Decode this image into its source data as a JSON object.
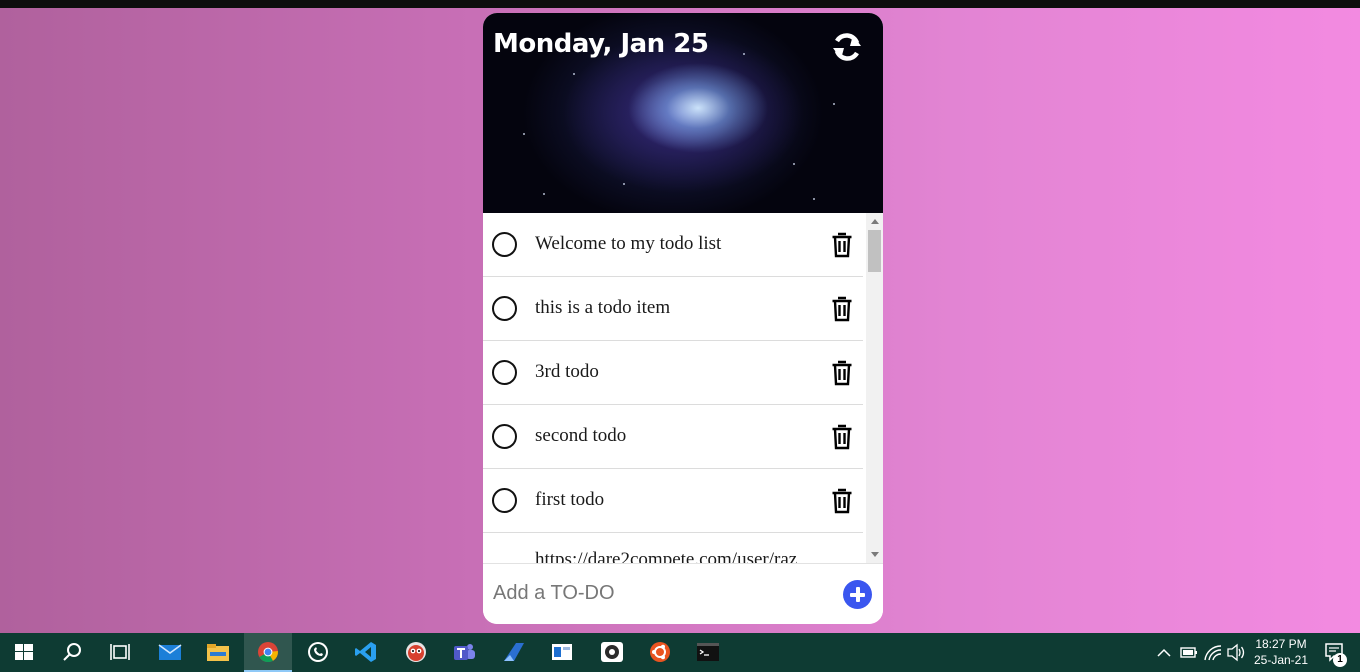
{
  "app": {
    "date_title": "Monday, Jan 25",
    "todos": [
      {
        "text": "Welcome to my todo list",
        "done": false
      },
      {
        "text": "this is a todo item",
        "done": false
      },
      {
        "text": "3rd todo",
        "done": false
      },
      {
        "text": "second todo",
        "done": false
      },
      {
        "text": "first todo",
        "done": false
      }
    ],
    "partial_item_text": "https://dare2compete.com/user/raz",
    "add_placeholder": "Add a TO-DO",
    "accent_color": "#3a56ef"
  },
  "taskbar": {
    "pinned": [
      "start-icon",
      "search-icon",
      "task-view-icon",
      "mail-icon",
      "file-explorer-icon",
      "chrome-icon",
      "whatsapp-icon",
      "vscode-icon",
      "app-icon",
      "teams-icon",
      "app-icon-blue",
      "app-icon-window",
      "app-icon-gray",
      "ubuntu-icon",
      "terminal-icon"
    ],
    "time": "18:27 PM",
    "date": "25-Jan-21",
    "notification_count": "1"
  }
}
